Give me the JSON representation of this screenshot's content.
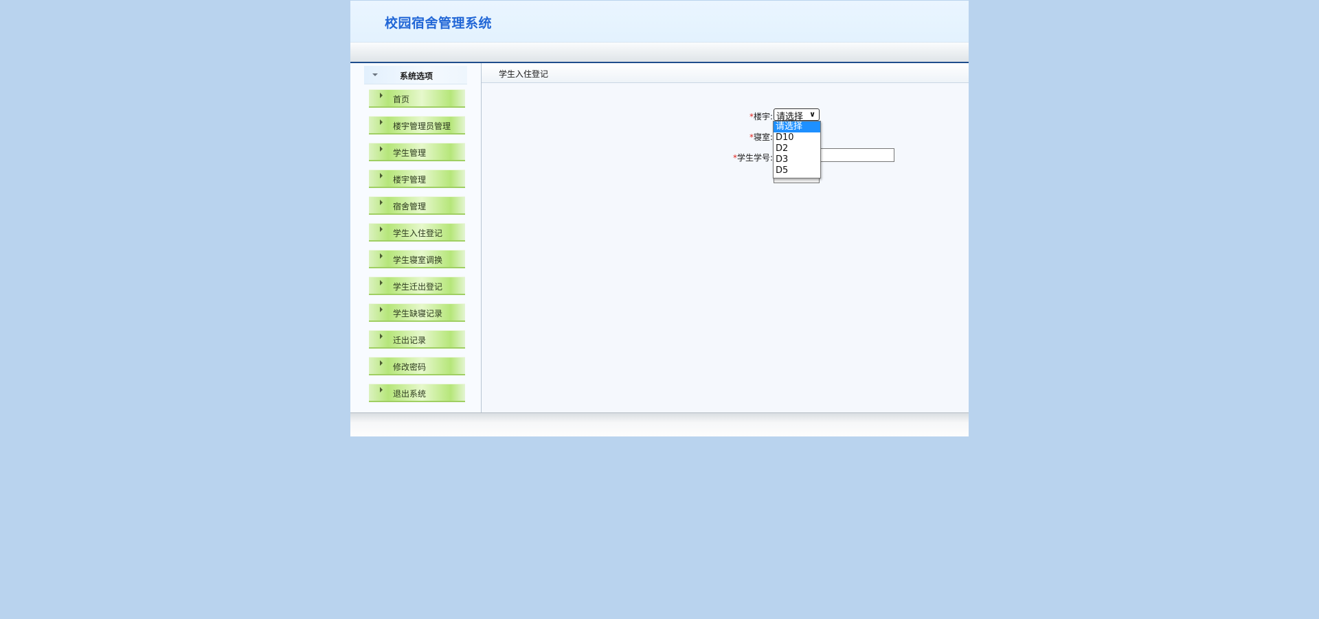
{
  "app": {
    "title": "校园宿舍管理系统"
  },
  "sidebar": {
    "header": "系统选项",
    "items": [
      {
        "label": "首页"
      },
      {
        "label": "楼宇管理员管理"
      },
      {
        "label": "学生管理"
      },
      {
        "label": "楼宇管理"
      },
      {
        "label": "宿舍管理"
      },
      {
        "label": "学生入住登记"
      },
      {
        "label": "学生寝室调换"
      },
      {
        "label": "学生迁出登记"
      },
      {
        "label": "学生缺寝记录"
      },
      {
        "label": "迁出记录"
      },
      {
        "label": "修改密码"
      },
      {
        "label": "退出系统"
      }
    ]
  },
  "content": {
    "title": "学生入住登记",
    "form": {
      "required_mark": "*",
      "building_label": "楼宇:",
      "room_label": "寝室:",
      "student_id_label": "学生学号:",
      "building_value": "请选择",
      "student_id_value": ""
    },
    "dropdown": {
      "options": [
        "请选择",
        "D10",
        "D2",
        "D3",
        "D5"
      ],
      "selected": "请选择"
    }
  },
  "colors": {
    "background": "#b9d3ee",
    "brand": "#2166d6",
    "required": "#e0251f",
    "menu_green": "#b6e67a",
    "selection": "#1e90ff"
  }
}
